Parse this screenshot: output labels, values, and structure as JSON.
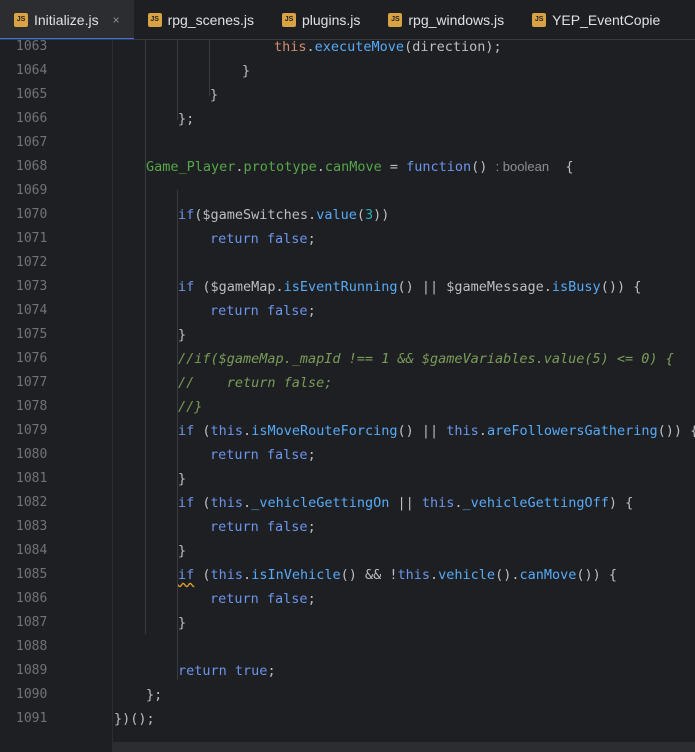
{
  "tabs": [
    {
      "label": "Initialize.js",
      "active": true,
      "closable": true
    },
    {
      "label": "rpg_scenes.js",
      "active": false
    },
    {
      "label": "plugins.js",
      "active": false
    },
    {
      "label": "rpg_windows.js",
      "active": false
    },
    {
      "label": "YEP_EventCopie",
      "active": false
    }
  ],
  "file_icon_text": "JS",
  "close_glyph": "×",
  "line_numbers": [
    "1063",
    "1064",
    "1065",
    "1066",
    "1067",
    "1068",
    "1069",
    "1070",
    "1071",
    "1072",
    "1073",
    "1074",
    "1075",
    "1076",
    "1077",
    "1078",
    "1079",
    "1080",
    "1081",
    "1082",
    "1083",
    "1084",
    "1085",
    "1086",
    "1087",
    "1088",
    "1089",
    "1090",
    "1091"
  ],
  "code": {
    "l1063": {
      "a": "this",
      "b": ".",
      "c": "executeMove",
      "d": "(direction);"
    },
    "l1064": "}",
    "l1065": "}",
    "l1066": "};",
    "l1068": {
      "a": "Game_Player",
      "b": ".",
      "c": "prototype",
      "d": ".",
      "e": "canMove",
      "f": " = ",
      "g": "function",
      "h": "()",
      "hint": ": boolean",
      "i": "  {"
    },
    "l1070": {
      "a": "if",
      "b": "($gameSwitches.",
      "c": "value",
      "d": "(",
      "e": "3",
      "f": "))"
    },
    "l1071": {
      "a": "return",
      "b": " ",
      "c": "false",
      "d": ";"
    },
    "l1073": {
      "a": "if",
      "b": " ($gameMap.",
      "c": "isEventRunning",
      "d": "() || $gameMessage.",
      "e": "isBusy",
      "f": "()) {"
    },
    "l1074": {
      "a": "return",
      "b": " ",
      "c": "false",
      "d": ";"
    },
    "l1075": "}",
    "l1076": "//if($gameMap._mapId !== 1 && $gameVariables.value(5) <= 0) {",
    "l1077": "//    return false;",
    "l1078": "//}",
    "l1079": {
      "a": "if",
      "b": " (",
      "c": "this",
      "d": ".",
      "e": "isMoveRouteForcing",
      "f": "() || ",
      "g": "this",
      "h": ".",
      "i": "areFollowersGathering",
      "j": "()) {"
    },
    "l1080": {
      "a": "return",
      "b": " ",
      "c": "false",
      "d": ";"
    },
    "l1081": "}",
    "l1082": {
      "a": "if",
      "b": " (",
      "c": "this",
      "d": ".",
      "e": "_vehicleGettingOn",
      "f": " || ",
      "g": "this",
      "h": ".",
      "i": "_vehicleGettingOff",
      "j": ") {"
    },
    "l1083": {
      "a": "return",
      "b": " ",
      "c": "false",
      "d": ";"
    },
    "l1084": "}",
    "l1085": {
      "a": "if",
      "b": " (",
      "c": "this",
      "d": ".",
      "e": "isInVehicle",
      "f": "() && !",
      "g": "this",
      "h": ".",
      "i": "vehicle",
      "j": "().",
      "k": "canMove",
      "l": "()) {"
    },
    "l1086": {
      "a": "return",
      "b": " ",
      "c": "false",
      "d": ";"
    },
    "l1087": "}",
    "l1089": {
      "a": "return",
      "b": " ",
      "c": "true",
      "d": ";"
    },
    "l1090": "};",
    "l1091": "})();"
  },
  "colors": {
    "background": "#1e1f22",
    "keyword": "#cf8e6d",
    "function_call": "#57aaf7",
    "class_name": "#57a64a",
    "comment": "#7a9c5a",
    "number": "#2aacb8",
    "accent": "#3574f0"
  }
}
